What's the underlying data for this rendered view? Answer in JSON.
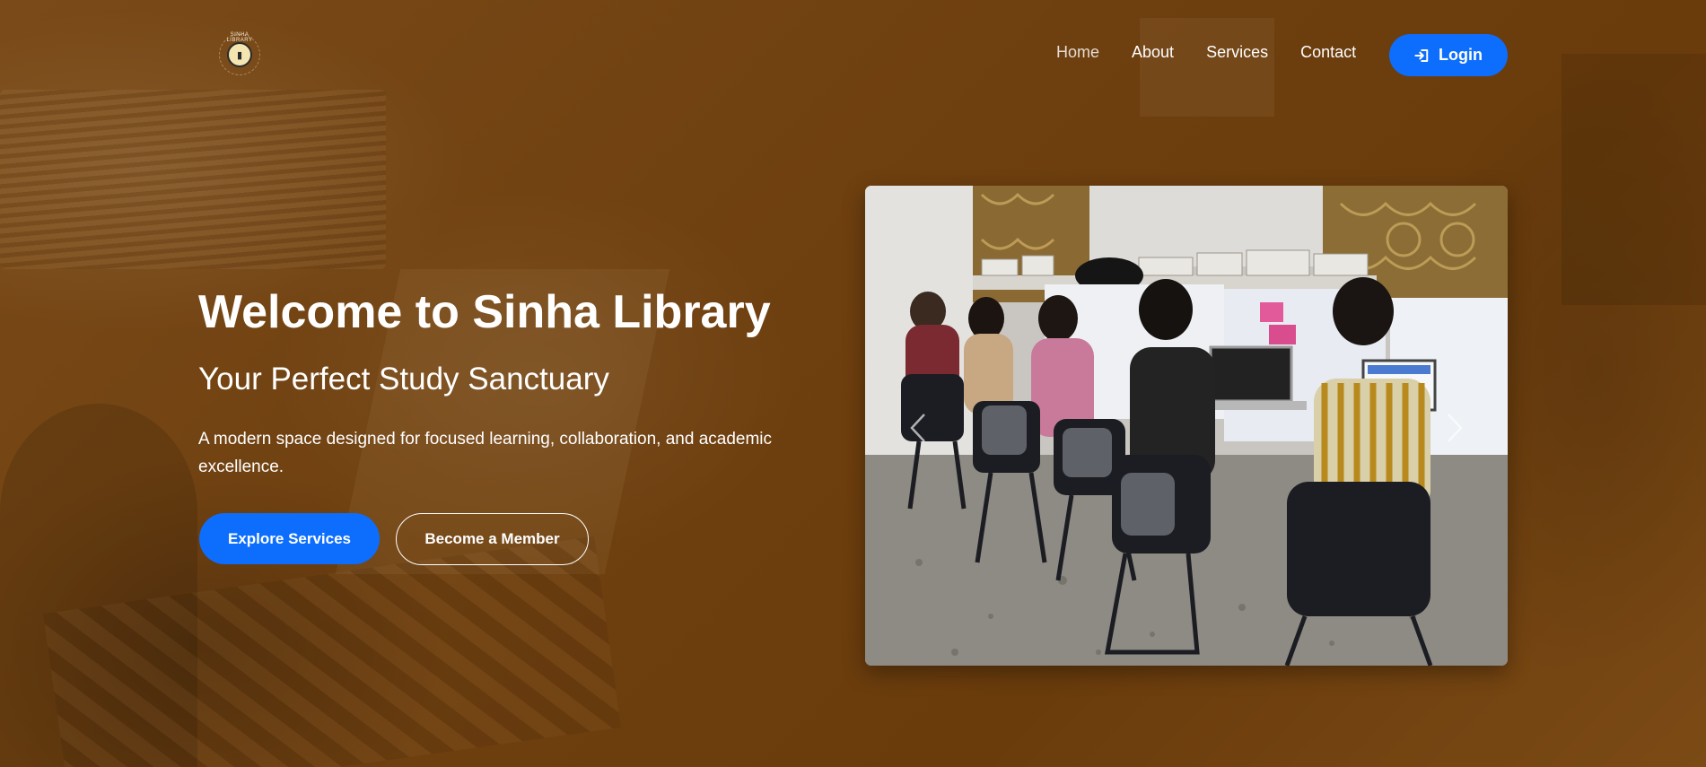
{
  "brand": {
    "logo_text": "SINHA LIBRARY",
    "logo_icon": "book-icon"
  },
  "nav": {
    "items": [
      {
        "label": "Home",
        "active": true
      },
      {
        "label": "About",
        "active": false
      },
      {
        "label": "Services",
        "active": false
      },
      {
        "label": "Contact",
        "active": false
      }
    ],
    "login": {
      "label": "Login",
      "icon": "sign-in-icon"
    }
  },
  "hero": {
    "title": "Welcome to Sinha Library",
    "subtitle": "Your Perfect Study Sanctuary",
    "description": "A modern space designed for focused learning, collaboration, and academic excellence.",
    "primary_button": "Explore Services",
    "secondary_button": "Become a Member"
  },
  "carousel": {
    "prev_icon": "chevron-left-icon",
    "next_icon": "chevron-right-icon"
  },
  "colors": {
    "accent": "#0d6efd",
    "overlay": "#6b3f10",
    "text": "#ffffff"
  }
}
